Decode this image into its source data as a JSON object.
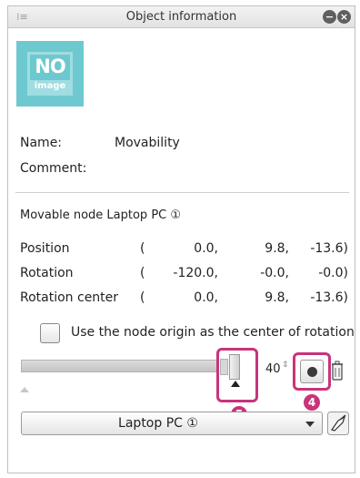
{
  "window": {
    "title": "Object information",
    "grip_glyph": "⁞≡",
    "minimize_glyph": "−",
    "close_glyph": "×"
  },
  "thumbnail": {
    "line1": "NO",
    "line2": "image"
  },
  "fields": {
    "name_label": "Name:",
    "name_value": "Movability",
    "comment_label": "Comment:"
  },
  "node": {
    "label": "Movable node",
    "value": "Laptop PC ①"
  },
  "transform": {
    "rows": [
      {
        "label": "Position",
        "open": "(",
        "x": "0.0,",
        "y": "9.8,",
        "z": "-13.6)"
      },
      {
        "label": "Rotation",
        "open": "(",
        "x": "-120.0,",
        "y": "-0.0,",
        "z": "-0.0)"
      },
      {
        "label": "Rotation center",
        "open": "(",
        "x": "0.0,",
        "y": "9.8,",
        "z": "-13.6)"
      }
    ]
  },
  "options": {
    "use_origin_label": "Use the node origin as the center of rotation",
    "use_origin_checked": false
  },
  "timeline": {
    "value": "40",
    "stepper_glyph": "⇕"
  },
  "annotations": {
    "badge_record": "4",
    "badge_slider": "5",
    "color": "#c8347a"
  },
  "selector": {
    "value": "Laptop PC ①"
  },
  "icons": [
    "grip-icon",
    "minimize-icon",
    "close-icon",
    "record-icon",
    "trash-icon",
    "dropdown-arrow-icon",
    "pick-node-icon"
  ]
}
